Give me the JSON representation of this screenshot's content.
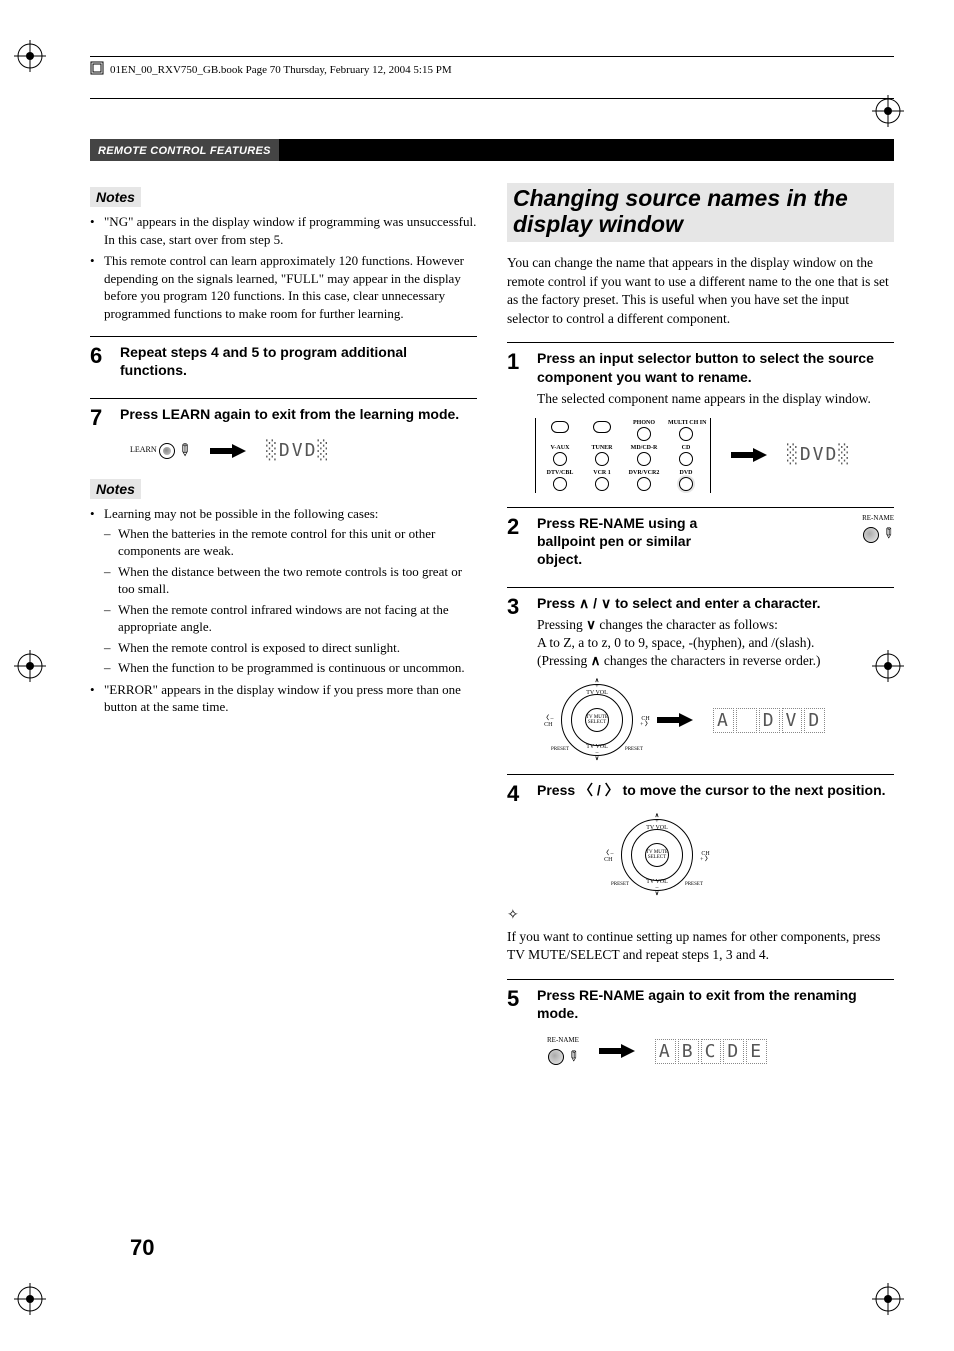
{
  "book_header": "01EN_00_RXV750_GB.book  Page 70  Thursday, February 12, 2004  5:15 PM",
  "section_bar": "REMOTE CONTROL FEATURES",
  "left": {
    "notes1_heading": "Notes",
    "notes1_items": [
      "\"NG\" appears in the display window if programming was unsuccessful. In this case, start over from step 5.",
      "This remote control can learn approximately 120 functions. However depending on the signals learned, \"FULL\" may appear in the display before you program 120 functions. In this case, clear unnecessary programmed functions to make room for further learning."
    ],
    "step6_num": "6",
    "step6_title": "Repeat steps 4 and 5 to program additional functions.",
    "step7_num": "7",
    "step7_title": "Press LEARN again to exit from the learning mode.",
    "learn_btn_label": "LEARN",
    "learn_display": "DVD",
    "notes2_heading": "Notes",
    "notes2_lead": "Learning may not be possible in the following cases:",
    "notes2_sub": [
      "When the batteries in the remote control for this unit or other components are weak.",
      "When the distance between the two remote controls is too great or too small.",
      "When the remote control infrared windows are not facing at the appropriate angle.",
      "When the remote control is exposed to direct sunlight.",
      "When the function to be programmed is continuous or uncommon."
    ],
    "notes2_tail": "\"ERROR\" appears in the display window if you press more than one button at the same time."
  },
  "right": {
    "heading": "Changing source names in the display window",
    "intro": "You can change the name that appears in the display window on the remote control if you want to use a different name to the one that is set as the factory preset. This is useful when you have set the input selector to control a different component.",
    "step1_num": "1",
    "step1_title": "Press an input selector button to select the source component you want to rename.",
    "step1_desc": "The selected component name appears in the display window.",
    "remote_labels": {
      "r1": [
        "",
        "",
        "PHONO",
        "MULTI CH IN"
      ],
      "r2": [
        "V-AUX",
        "TUNER",
        "MD/CD-R",
        "CD"
      ],
      "r3": [
        "DTV/CBL",
        "VCR 1",
        "DVR/VCR2",
        "DVD"
      ]
    },
    "step1_display": "DVD",
    "step2_num": "2",
    "step2_title": "Press RE-NAME using a ballpoint pen or similar object.",
    "rename_label": "RE-NAME",
    "step3_num": "3",
    "step3_title_pre": "Press ",
    "step3_title_post": " to select and enter a character.",
    "step3_desc1_pre": "Pressing ",
    "step3_desc1_post": " changes the character as follows:",
    "step3_desc2": "A to Z, a to z, 0 to 9, space, -(hyphen), and /(slash).",
    "step3_desc3_pre": "(Pressing ",
    "step3_desc3_post": " changes the characters in reverse order.)",
    "dpad": {
      "center": "TV MUTE SELECT",
      "n_sign": "+",
      "n_lab": "TV VOL",
      "s_sign": "–",
      "s_lab": "TV VOL",
      "e_sign": "+",
      "e_lab": "CH",
      "w_sign": "–",
      "w_lab": "CH",
      "se": "PRESET",
      "sw": "PRESET"
    },
    "step3_display": "A DVD",
    "step4_num": "4",
    "step4_title_pre": "Press ",
    "step4_title_post": " to move the cursor to the next position.",
    "tip_text": "If you want to continue setting up names for other components, press TV MUTE/SELECT and repeat steps 1, 3 and 4.",
    "step5_num": "5",
    "step5_title": "Press RE-NAME again to exit from the renaming mode.",
    "step5_display": "ABCDE"
  },
  "page_number": "70"
}
